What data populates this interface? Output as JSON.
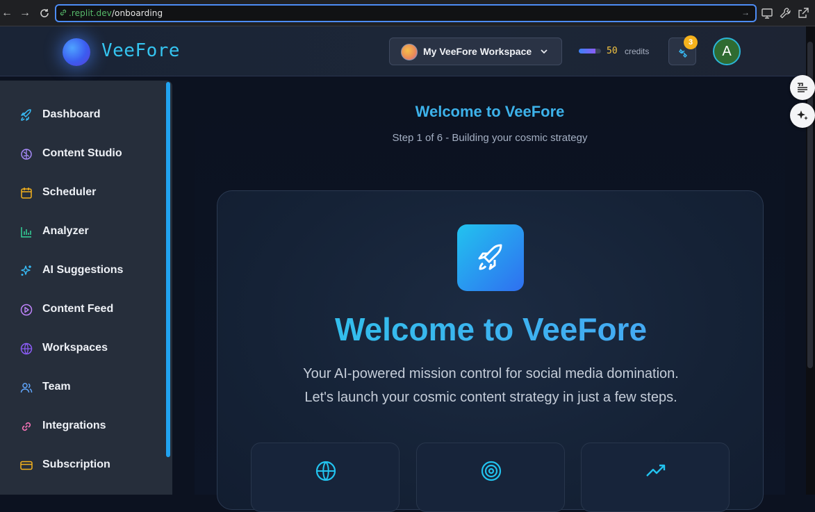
{
  "browser": {
    "url_domain": ".replit.dev",
    "url_path": "/onboarding",
    "icons": [
      "back-icon",
      "forward-icon",
      "reload-icon",
      "link-icon",
      "go-icon",
      "screen-icon",
      "wrench-icon",
      "open-external-icon"
    ]
  },
  "header": {
    "logo_text": "VeeFore",
    "workspace_label": "My VeeFore Workspace",
    "credits_value": "50",
    "credits_label": "credits",
    "credits_level": 0.75,
    "notification_count": "3",
    "avatar_initial": "A"
  },
  "sidebar": {
    "items": [
      {
        "label": "Dashboard",
        "icon": "rocket-icon",
        "color": "#38bdf8"
      },
      {
        "label": "Content Studio",
        "icon": "brain-icon",
        "color": "#a78bfa"
      },
      {
        "label": "Scheduler",
        "icon": "calendar-icon",
        "color": "#f5b21c"
      },
      {
        "label": "Analyzer",
        "icon": "bar-chart-icon",
        "color": "#34d399"
      },
      {
        "label": "AI Suggestions",
        "icon": "sparkles-icon",
        "color": "#38bdf8"
      },
      {
        "label": "Content Feed",
        "icon": "play-circle-icon",
        "color": "#c084fc"
      },
      {
        "label": "Workspaces",
        "icon": "globe-icon",
        "color": "#8b5cf6"
      },
      {
        "label": "Team",
        "icon": "users-icon",
        "color": "#60a5fa"
      },
      {
        "label": "Integrations",
        "icon": "link-icon",
        "color": "#f472b6"
      },
      {
        "label": "Subscription",
        "icon": "credit-card-icon",
        "color": "#f5b21c"
      }
    ]
  },
  "main": {
    "title": "Welcome to VeeFore",
    "subtitle": "Step 1 of 6 - Building your cosmic strategy",
    "hero_title": "Welcome to VeeFore",
    "hero_line1": "Your AI-powered mission control for social media domination.",
    "hero_line2": "Let's launch your cosmic content strategy in just a few steps.",
    "features": [
      {
        "icon": "globe-icon"
      },
      {
        "icon": "target-icon"
      },
      {
        "icon": "trending-up-icon"
      }
    ]
  },
  "colors": {
    "accent": "#36b8ec",
    "sidebar_bg": "#262e3b",
    "badge": "#f5b21c"
  }
}
